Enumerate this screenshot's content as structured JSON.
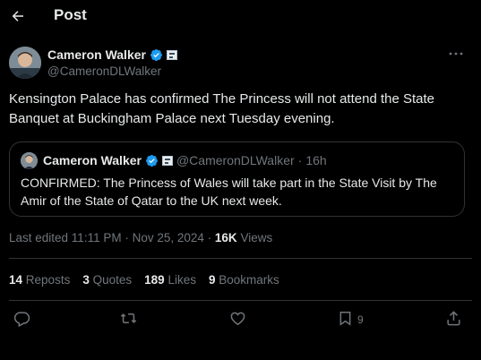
{
  "header": {
    "title": "Post"
  },
  "author": {
    "name": "Cameron Walker",
    "handle": "@CameronDLWalker"
  },
  "tweet": {
    "text": "Kensington Palace has confirmed The Princess will not attend the State Banquet at Buckingham Palace next Tuesday evening."
  },
  "quote": {
    "name": "Cameron Walker",
    "handle": "@CameronDLWalker",
    "separator": "·",
    "time": "16h",
    "text": "CONFIRMED: The Princess of Wales will take part in the State Visit by The Amir of the State of Qatar to the UK next week."
  },
  "meta": {
    "edited": "Last edited 11:11 PM · Nov 25, 2024 ·",
    "views_count": "16K",
    "views_label": "Views"
  },
  "stats": {
    "reposts_count": "14",
    "reposts_label": "Reposts",
    "quotes_count": "3",
    "quotes_label": "Quotes",
    "likes_count": "189",
    "likes_label": "Likes",
    "bookmarks_count": "9",
    "bookmarks_label": "Bookmarks"
  },
  "actions": {
    "bookmark_count": "9"
  },
  "icons": [
    "back-arrow-icon",
    "more-icon",
    "verified-badge-icon",
    "affiliate-badge-icon",
    "reply-icon",
    "repost-icon",
    "like-icon",
    "bookmark-icon",
    "share-icon"
  ],
  "colors": {
    "background": "#000000",
    "text": "#e7e9ea",
    "muted": "#71767b",
    "verified": "#1d9bf0",
    "border": "#2f3336"
  }
}
